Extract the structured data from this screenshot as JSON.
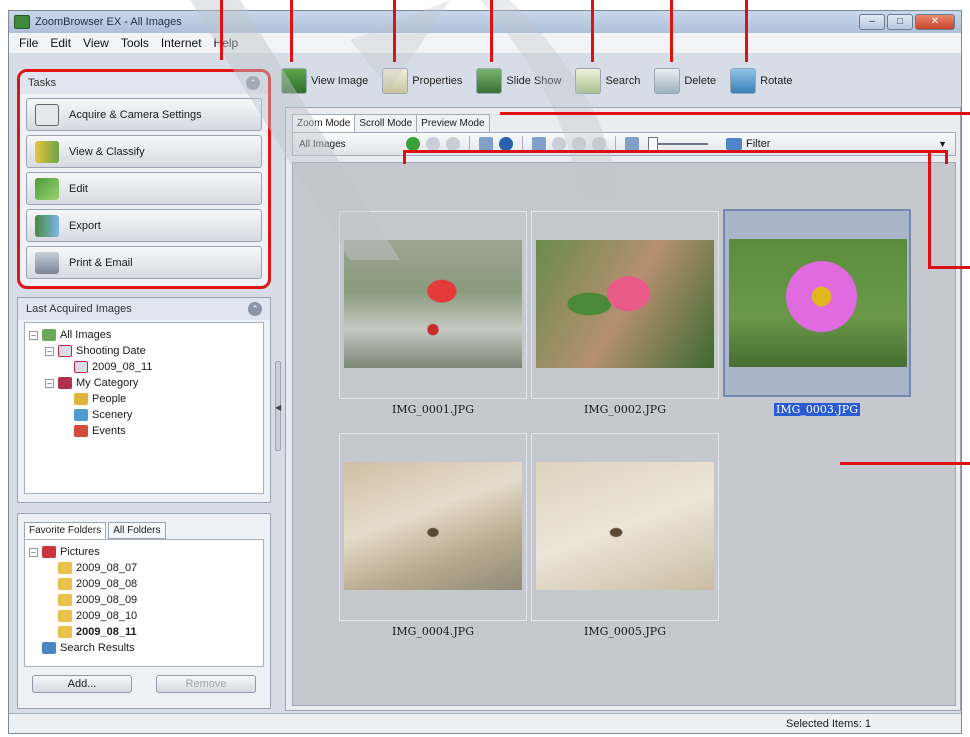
{
  "window": {
    "title": "ZoomBrowser EX  -  All Images",
    "controls": {
      "minimize": "–",
      "maximize": "□",
      "close": "✕"
    }
  },
  "menu": [
    "File",
    "Edit",
    "View",
    "Tools",
    "Internet",
    "Help"
  ],
  "toolbar": {
    "view_image": "View Image",
    "properties": "Properties",
    "slide_show": "Slide Show",
    "search": "Search",
    "delete": "Delete",
    "rotate": "Rotate"
  },
  "tasks": {
    "title": "Tasks",
    "items": [
      "Acquire & Camera Settings",
      "View & Classify",
      "Edit",
      "Export",
      "Print & Email"
    ]
  },
  "last_acquired": {
    "title": "Last Acquired Images",
    "tree": [
      {
        "label": "All Images",
        "level": 0,
        "icon": "all-images-icon",
        "expander": "–"
      },
      {
        "label": "Shooting Date",
        "level": 1,
        "icon": "calendar-icon",
        "expander": "–"
      },
      {
        "label": "2009_08_11",
        "level": 2,
        "icon": "calendar-icon",
        "expander": ""
      },
      {
        "label": "My Category",
        "level": 1,
        "icon": "category-icon",
        "expander": "–"
      },
      {
        "label": "People",
        "level": 2,
        "icon": "people-icon",
        "expander": ""
      },
      {
        "label": "Scenery",
        "level": 2,
        "icon": "scenery-icon",
        "expander": ""
      },
      {
        "label": "Events",
        "level": 2,
        "icon": "events-icon",
        "expander": ""
      }
    ]
  },
  "favorites": {
    "tabs": [
      "Favorite Folders",
      "All Folders"
    ],
    "tree": [
      {
        "label": "Pictures",
        "level": 0,
        "icon": "pictures-icon",
        "expander": "–",
        "bold": false
      },
      {
        "label": "2009_08_07",
        "level": 1,
        "icon": "folder-icon",
        "expander": "",
        "bold": false
      },
      {
        "label": "2009_08_08",
        "level": 1,
        "icon": "folder-icon",
        "expander": "",
        "bold": false
      },
      {
        "label": "2009_08_09",
        "level": 1,
        "icon": "folder-icon",
        "expander": "",
        "bold": false
      },
      {
        "label": "2009_08_10",
        "level": 1,
        "icon": "folder-icon",
        "expander": "",
        "bold": false
      },
      {
        "label": "2009_08_11",
        "level": 1,
        "icon": "folder-icon",
        "expander": "",
        "bold": true
      },
      {
        "label": "Search Results",
        "level": 0,
        "icon": "search-results-icon",
        "expander": "",
        "bold": false
      }
    ],
    "add_label": "Add...",
    "remove_label": "Remove"
  },
  "main": {
    "mode_tabs": [
      "Zoom Mode",
      "Scroll Mode",
      "Preview Mode"
    ],
    "breadcrumb": "All Images",
    "filter_label": "Filter",
    "thumbnails": [
      {
        "name": "IMG_0001.JPG",
        "selected": false
      },
      {
        "name": "IMG_0002.JPG",
        "selected": false
      },
      {
        "name": "IMG_0003.JPG",
        "selected": true
      },
      {
        "name": "IMG_0004.JPG",
        "selected": false
      },
      {
        "name": "IMG_0005.JPG",
        "selected": false
      }
    ]
  },
  "status": {
    "selected_items": "Selected Items: 1"
  },
  "colors": {
    "annotation": "#dd1111",
    "selection": "#2a5bd0"
  }
}
